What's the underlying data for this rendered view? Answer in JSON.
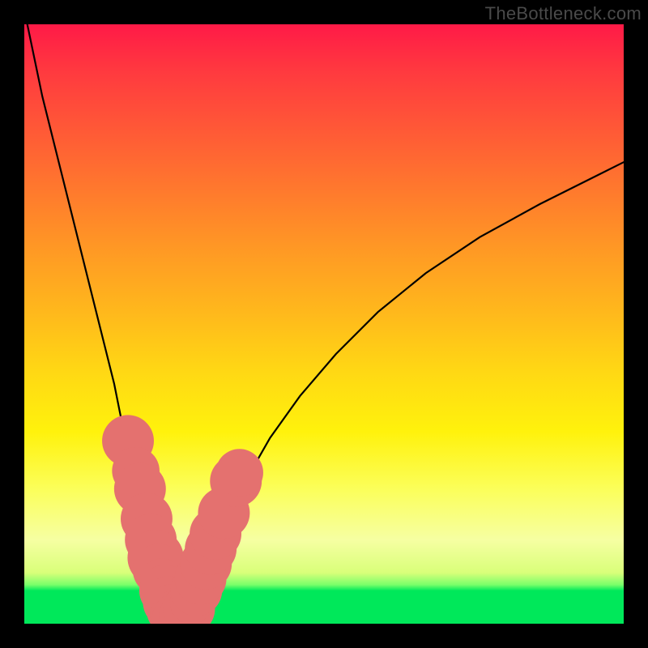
{
  "watermark": "TheBottleneck.com",
  "chart_data": {
    "type": "line",
    "title": "",
    "xlabel": "",
    "ylabel": "",
    "xlim": [
      0,
      100
    ],
    "ylim": [
      0,
      100
    ],
    "series": [
      {
        "name": "left-branch",
        "x": [
          0.5,
          3,
          6,
          9,
          12,
          15,
          17,
          19,
          20.5,
          21.8,
          22.6,
          23.2,
          23.7,
          24.2,
          24.7,
          25.3,
          26.0
        ],
        "y": [
          100,
          88,
          76,
          64,
          52,
          40,
          30,
          22,
          16,
          11,
          8,
          6,
          4.5,
          3.2,
          2.2,
          1.2,
          0.5
        ]
      },
      {
        "name": "right-branch",
        "x": [
          26.0,
          26.6,
          27.3,
          28.1,
          29.0,
          30.2,
          31.8,
          34,
          37,
          41,
          46,
          52,
          59,
          67,
          76,
          86,
          96,
          100
        ],
        "y": [
          0.5,
          1.3,
          2.6,
          4.4,
          6.6,
          9.4,
          13.0,
          18,
          24,
          31,
          38,
          45,
          52,
          58.5,
          64.5,
          70,
          75,
          77
        ]
      }
    ],
    "dots": {
      "name": "sample-points",
      "points": [
        {
          "x": 17.3,
          "y": 30.5,
          "r": 1.2
        },
        {
          "x": 18.6,
          "y": 25.5,
          "r": 1.1
        },
        {
          "x": 19.3,
          "y": 22.5,
          "r": 1.2
        },
        {
          "x": 20.4,
          "y": 17.5,
          "r": 1.2
        },
        {
          "x": 21.1,
          "y": 14.0,
          "r": 1.2
        },
        {
          "x": 21.9,
          "y": 11.0,
          "r": 1.3
        },
        {
          "x": 22.4,
          "y": 9.0,
          "r": 1.2
        },
        {
          "x": 22.9,
          "y": 7.3,
          "r": 1.0
        },
        {
          "x": 23.5,
          "y": 5.5,
          "r": 1.2
        },
        {
          "x": 24.1,
          "y": 3.6,
          "r": 1.2
        },
        {
          "x": 24.7,
          "y": 2.3,
          "r": 1.2
        },
        {
          "x": 25.3,
          "y": 1.3,
          "r": 1.2
        },
        {
          "x": 26.0,
          "y": 0.8,
          "r": 1.3
        },
        {
          "x": 26.8,
          "y": 1.2,
          "r": 1.2
        },
        {
          "x": 27.5,
          "y": 2.5,
          "r": 1.2
        },
        {
          "x": 27.9,
          "y": 3.6,
          "r": 1.0
        },
        {
          "x": 28.7,
          "y": 5.6,
          "r": 1.2
        },
        {
          "x": 29.4,
          "y": 7.5,
          "r": 1.2
        },
        {
          "x": 30.3,
          "y": 10.0,
          "r": 1.2
        },
        {
          "x": 31.1,
          "y": 12.5,
          "r": 1.2
        },
        {
          "x": 31.9,
          "y": 15.0,
          "r": 1.2
        },
        {
          "x": 33.3,
          "y": 18.5,
          "r": 1.2
        },
        {
          "x": 35.3,
          "y": 23.8,
          "r": 1.2
        },
        {
          "x": 35.9,
          "y": 25.2,
          "r": 1.1
        }
      ]
    },
    "gradient_stops": [
      {
        "pct": 0,
        "color": "#ff1a47"
      },
      {
        "pct": 50,
        "color": "#ffc018"
      },
      {
        "pct": 80,
        "color": "#fbff5e"
      },
      {
        "pct": 94,
        "color": "#00e85a"
      },
      {
        "pct": 100,
        "color": "#00e85a"
      }
    ]
  }
}
